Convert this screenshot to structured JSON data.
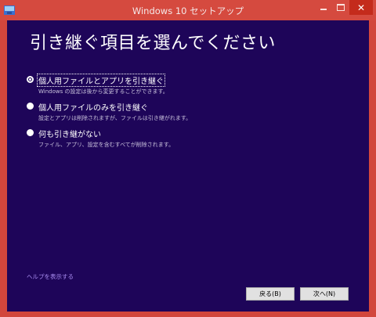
{
  "window": {
    "title": "Windows 10 セットアップ",
    "minimize_label": "–",
    "maximize_label": "□",
    "close_label": "✕"
  },
  "page": {
    "heading": "引き継ぐ項目を選んでください"
  },
  "options": [
    {
      "label": "個人用ファイルとアプリを引き継ぐ",
      "description": "Windows の設定は後から変更することができます。",
      "selected": true
    },
    {
      "label": "個人用ファイルのみを引き継ぐ",
      "description": "設定とアプリは削除されますが、ファイルは引き継がれます。",
      "selected": false
    },
    {
      "label": "何も引き継がない",
      "description": "ファイル、アプリ、設定を含むすべてが削除されます。",
      "selected": false
    }
  ],
  "footer": {
    "help_link": "ヘルプを表示する",
    "back_button": "戻る(B)",
    "next_button": "次へ(N)"
  },
  "colors": {
    "frame": "#d2463c",
    "content_bg": "#1e0559",
    "link": "#a88cf0"
  }
}
